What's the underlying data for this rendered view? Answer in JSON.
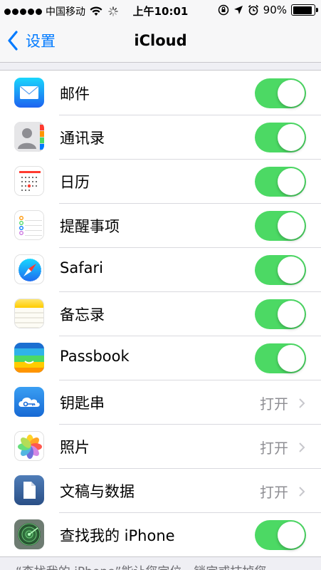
{
  "status_bar": {
    "carrier": "中国移动",
    "time": "上午10:01",
    "battery": "90%",
    "battery_level": 0.9
  },
  "nav": {
    "back_label": "设置",
    "title": "iCloud"
  },
  "rows": [
    {
      "label": "邮件",
      "icon": "mail-icon",
      "type": "toggle",
      "on": true
    },
    {
      "label": "通讯录",
      "icon": "contacts-icon",
      "type": "toggle",
      "on": true
    },
    {
      "label": "日历",
      "icon": "calendar-icon",
      "type": "toggle",
      "on": true
    },
    {
      "label": "提醒事项",
      "icon": "reminders-icon",
      "type": "toggle",
      "on": true
    },
    {
      "label": "Safari",
      "icon": "safari-icon",
      "type": "toggle",
      "on": true
    },
    {
      "label": "备忘录",
      "icon": "notes-icon",
      "type": "toggle",
      "on": true
    },
    {
      "label": "Passbook",
      "icon": "passbook-icon",
      "type": "toggle",
      "on": true
    },
    {
      "label": "钥匙串",
      "icon": "keychain-icon",
      "type": "detail",
      "value": "打开"
    },
    {
      "label": "照片",
      "icon": "photos-icon",
      "type": "detail",
      "value": "打开"
    },
    {
      "label": "文稿与数据",
      "icon": "documents-icon",
      "type": "detail",
      "value": "打开"
    },
    {
      "label": "查找我的 iPhone",
      "icon": "find-my-iphone-icon",
      "type": "toggle",
      "on": true
    }
  ],
  "footer": "“查找我的 iPhone”能让您定位、锁定或抹掉您",
  "colors": {
    "accent": "#007aff",
    "toggle_on": "#4cd964",
    "secondary_text": "#8e8e93"
  }
}
